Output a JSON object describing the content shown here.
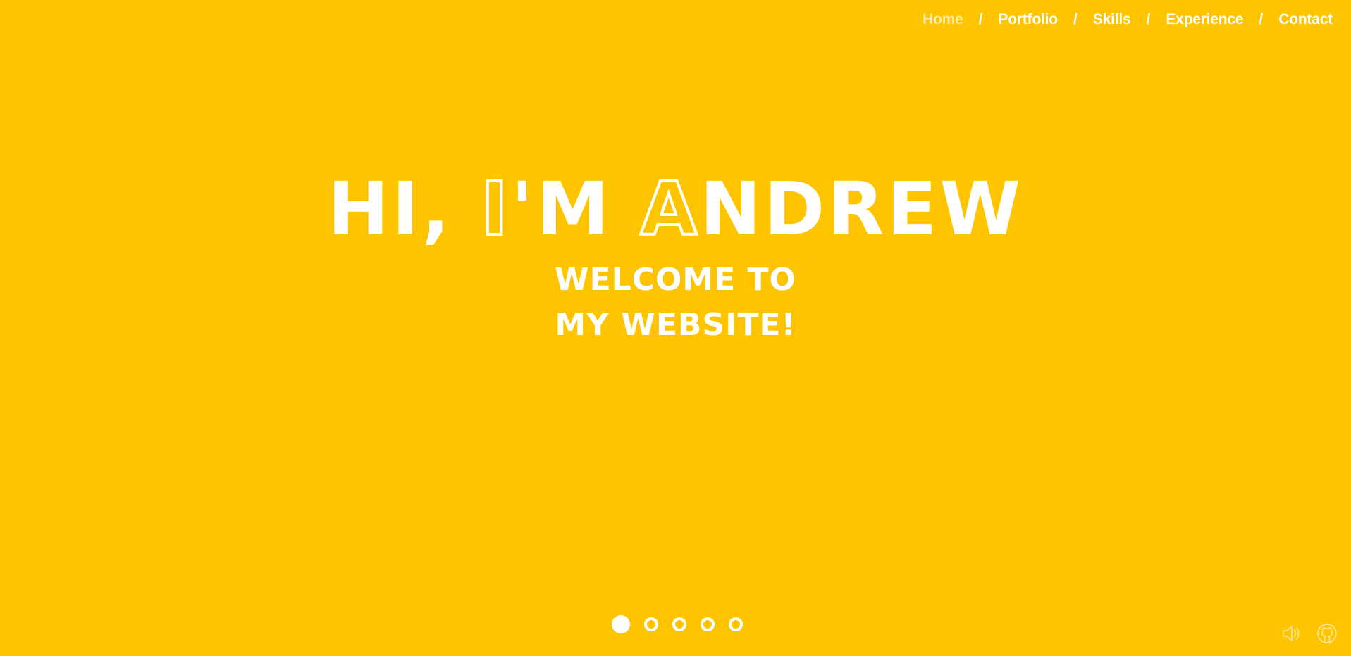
{
  "nav": {
    "items": [
      {
        "label": "Home",
        "active": true
      },
      {
        "label": "Portfolio",
        "active": false
      },
      {
        "label": "Skills",
        "active": false
      },
      {
        "label": "Experience",
        "active": false
      },
      {
        "label": "Contact",
        "active": false
      }
    ],
    "separator": "/"
  },
  "hero": {
    "title_part1": "HI, ",
    "title_part2": "I",
    "title_part3": "'M ",
    "title_part4": "A",
    "title_part5": "NDREW",
    "subtitle": "WELCOME TO MY WEBSITE!"
  },
  "slider": {
    "count": 5,
    "active_index": 0
  },
  "controls": {
    "sound_icon": "speaker-icon",
    "github_icon": "github-icon"
  },
  "colors": {
    "background": "#ffc400",
    "text": "#ffffff",
    "nav_active": "#ffe9a8"
  }
}
